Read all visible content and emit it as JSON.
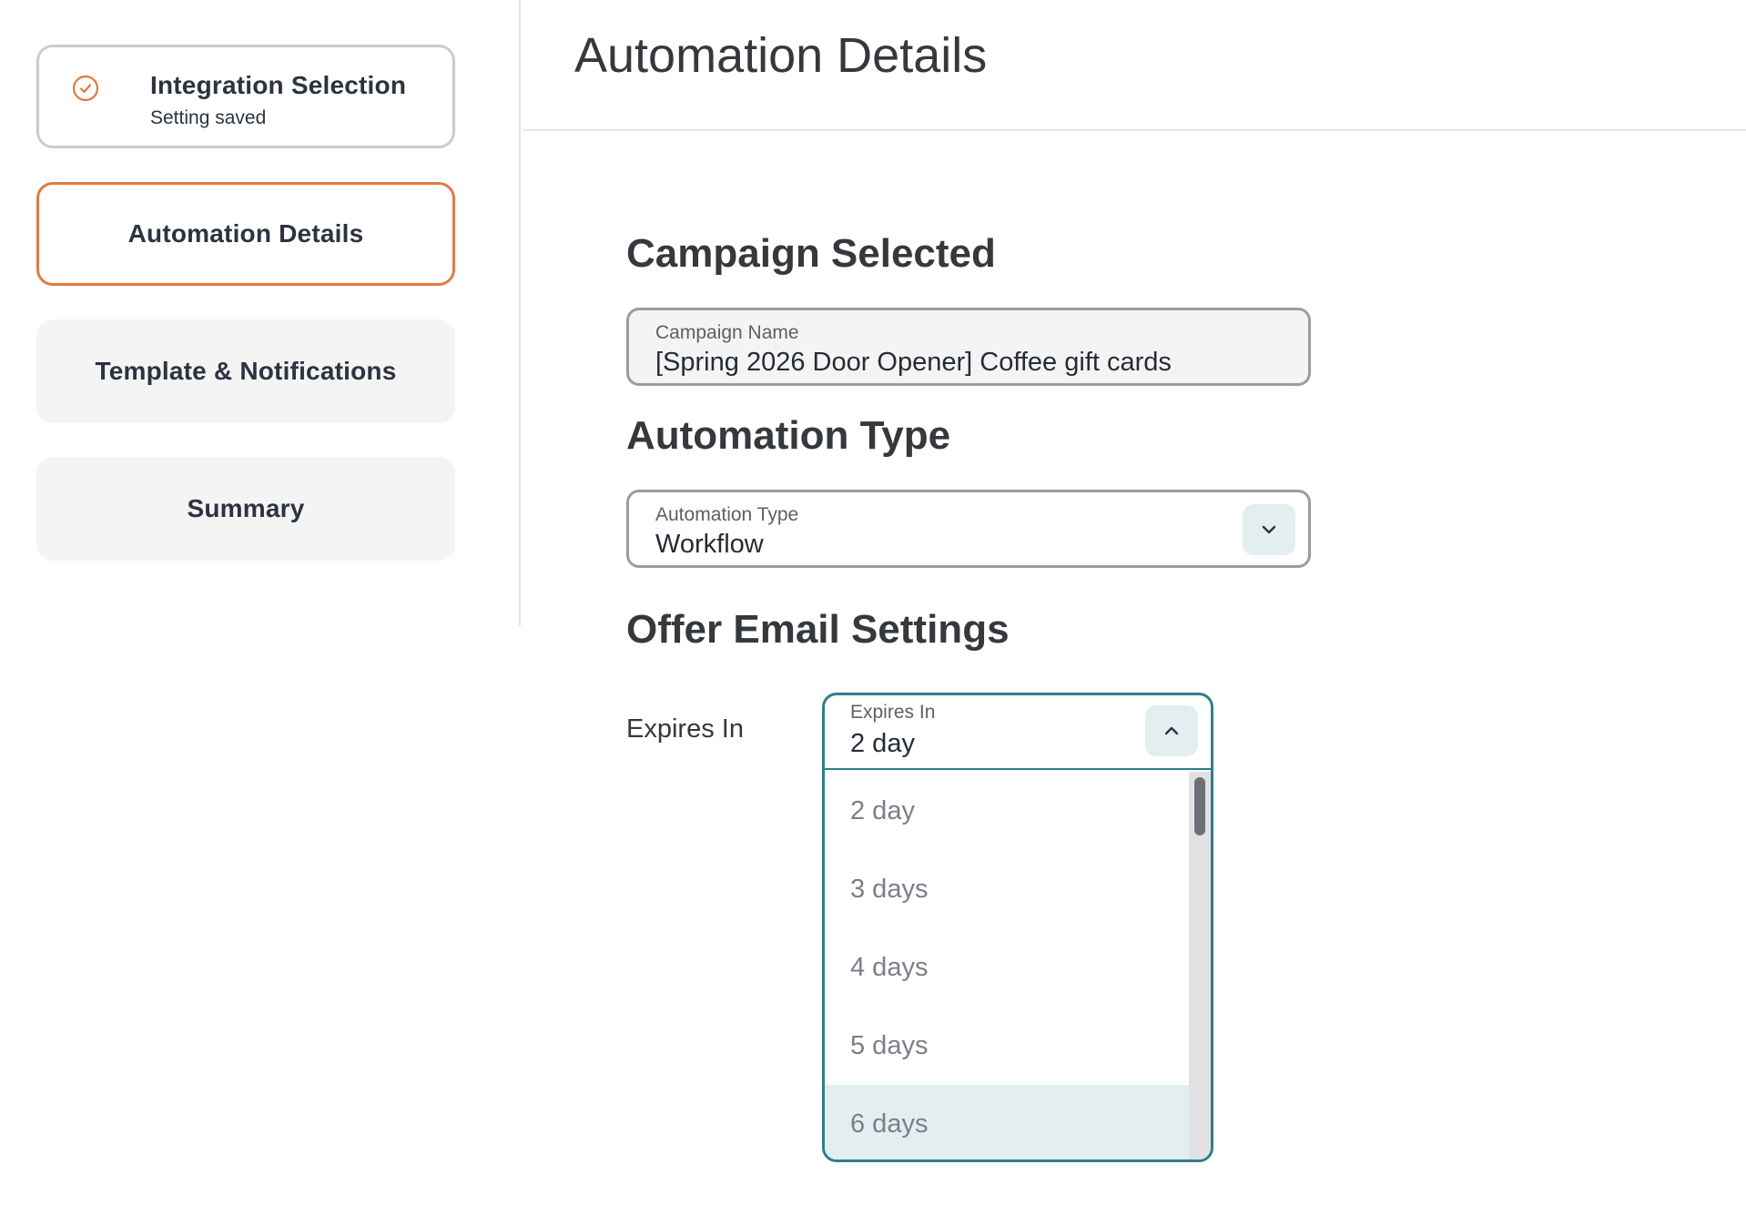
{
  "sidebar": {
    "steps": [
      {
        "label": "Integration Selection",
        "sublabel": "Setting saved",
        "state": "completed"
      },
      {
        "label": "Automation Details",
        "state": "active"
      },
      {
        "label": "Template & Notifications",
        "state": "pending"
      },
      {
        "label": "Summary",
        "state": "pending"
      }
    ]
  },
  "header": {
    "title": "Automation Details"
  },
  "main": {
    "campaign_section": {
      "title": "Campaign Selected",
      "field_label": "Campaign Name",
      "field_value": "[Spring 2026 Door Opener] Coffee gift cards"
    },
    "automation_section": {
      "title": "Automation Type",
      "field_label": "Automation Type",
      "field_value": "Workflow",
      "icon": "chevron-down-icon"
    },
    "offer_section": {
      "title": "Offer Email Settings",
      "expires_label": "Expires In",
      "dropdown": {
        "label": "Expires In",
        "value": "2 day",
        "icon": "chevron-up-icon",
        "options": [
          "2 day",
          "3 days",
          "4 days",
          "5 days",
          "6 days"
        ],
        "highlighted_option": "6 days"
      }
    }
  },
  "colors": {
    "accent_orange": "#e07b3f",
    "accent_teal": "#2e7f8a",
    "button_bg": "#e2eef0",
    "text_dark": "#2c3340"
  }
}
